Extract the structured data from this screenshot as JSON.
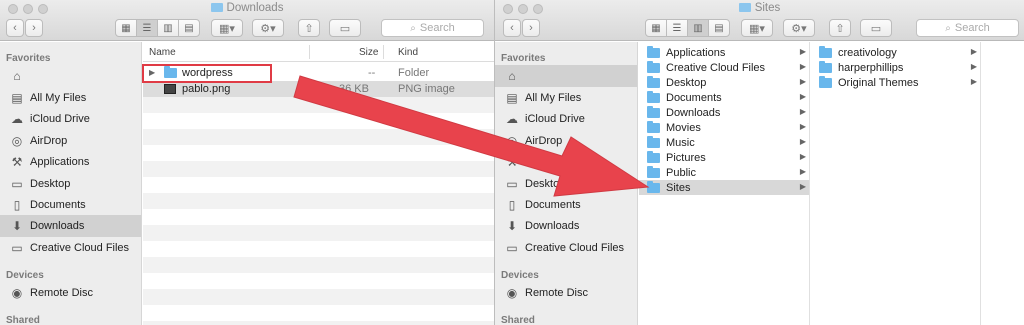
{
  "left_window": {
    "title": "Downloads",
    "search_placeholder": "Search",
    "sidebar": {
      "favorites_label": "Favorites",
      "items": [
        {
          "label": "",
          "icon": "home-icon"
        },
        {
          "label": "All My Files",
          "icon": "all-files-icon"
        },
        {
          "label": "iCloud Drive",
          "icon": "cloud-icon"
        },
        {
          "label": "AirDrop",
          "icon": "airdrop-icon"
        },
        {
          "label": "Applications",
          "icon": "applications-icon"
        },
        {
          "label": "Desktop",
          "icon": "desktop-icon"
        },
        {
          "label": "Documents",
          "icon": "documents-icon"
        },
        {
          "label": "Downloads",
          "icon": "downloads-icon",
          "selected": true
        },
        {
          "label": "Creative Cloud Files",
          "icon": "folder-icon"
        }
      ],
      "devices_label": "Devices",
      "devices": [
        {
          "label": "Remote Disc",
          "icon": "disc-icon"
        }
      ],
      "shared_label": "Shared"
    },
    "columns": {
      "name": "Name",
      "size": "Size",
      "kind": "Kind"
    },
    "files": [
      {
        "name": "wordpress",
        "size": "--",
        "kind": "Folder",
        "type": "folder"
      },
      {
        "name": "pablo.png",
        "size": "36 KB",
        "kind": "PNG image",
        "type": "image"
      }
    ]
  },
  "right_window": {
    "title": "Sites",
    "search_placeholder": "Search",
    "sidebar": {
      "favorites_label": "Favorites",
      "items": [
        {
          "label": "",
          "icon": "home-icon",
          "selected": true
        },
        {
          "label": "All My Files",
          "icon": "all-files-icon"
        },
        {
          "label": "iCloud Drive",
          "icon": "cloud-icon"
        },
        {
          "label": "AirDrop",
          "icon": "airdrop-icon"
        },
        {
          "label": "Applications",
          "icon": "applications-icon"
        },
        {
          "label": "Desktop",
          "icon": "desktop-icon"
        },
        {
          "label": "Documents",
          "icon": "documents-icon"
        },
        {
          "label": "Downloads",
          "icon": "downloads-icon"
        },
        {
          "label": "Creative Cloud Files",
          "icon": "folder-icon"
        }
      ],
      "devices_label": "Devices",
      "devices": [
        {
          "label": "Remote Disc",
          "icon": "disc-icon"
        }
      ],
      "shared_label": "Shared"
    },
    "column1": [
      {
        "name": "Applications"
      },
      {
        "name": "Creative Cloud Files"
      },
      {
        "name": "Desktop"
      },
      {
        "name": "Documents"
      },
      {
        "name": "Downloads"
      },
      {
        "name": "Movies"
      },
      {
        "name": "Music"
      },
      {
        "name": "Pictures"
      },
      {
        "name": "Public"
      },
      {
        "name": "Sites",
        "selected": true
      }
    ],
    "column2": [
      {
        "name": "creativology"
      },
      {
        "name": "harperphillips"
      },
      {
        "name": "Original Themes"
      }
    ]
  },
  "annotation": {
    "arrow_color": "#e8434c",
    "box_color": "#e03b45"
  }
}
